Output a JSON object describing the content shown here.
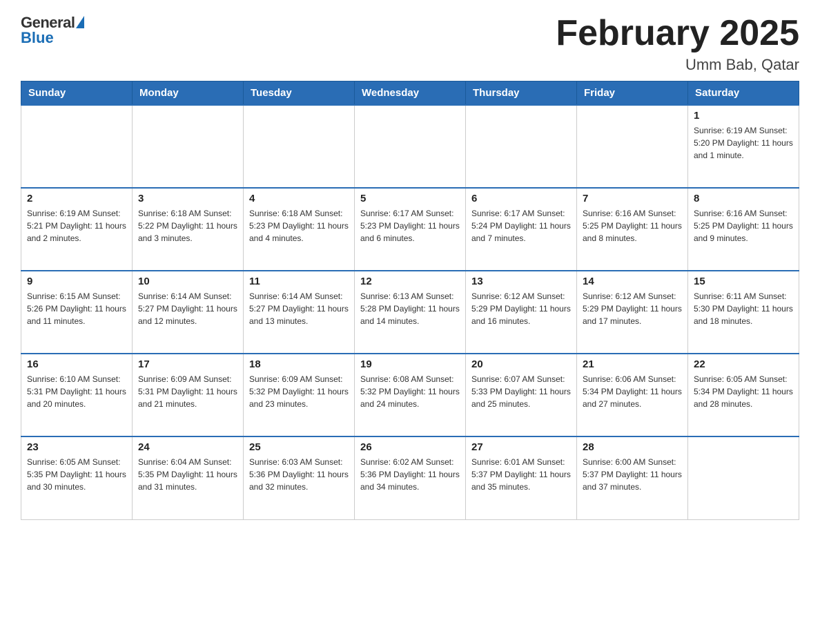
{
  "logo": {
    "general": "General",
    "blue": "Blue"
  },
  "header": {
    "title": "February 2025",
    "subtitle": "Umm Bab, Qatar"
  },
  "days_of_week": [
    "Sunday",
    "Monday",
    "Tuesday",
    "Wednesday",
    "Thursday",
    "Friday",
    "Saturday"
  ],
  "weeks": [
    [
      {
        "day": "",
        "info": ""
      },
      {
        "day": "",
        "info": ""
      },
      {
        "day": "",
        "info": ""
      },
      {
        "day": "",
        "info": ""
      },
      {
        "day": "",
        "info": ""
      },
      {
        "day": "",
        "info": ""
      },
      {
        "day": "1",
        "info": "Sunrise: 6:19 AM\nSunset: 5:20 PM\nDaylight: 11 hours and 1 minute."
      }
    ],
    [
      {
        "day": "2",
        "info": "Sunrise: 6:19 AM\nSunset: 5:21 PM\nDaylight: 11 hours and 2 minutes."
      },
      {
        "day": "3",
        "info": "Sunrise: 6:18 AM\nSunset: 5:22 PM\nDaylight: 11 hours and 3 minutes."
      },
      {
        "day": "4",
        "info": "Sunrise: 6:18 AM\nSunset: 5:23 PM\nDaylight: 11 hours and 4 minutes."
      },
      {
        "day": "5",
        "info": "Sunrise: 6:17 AM\nSunset: 5:23 PM\nDaylight: 11 hours and 6 minutes."
      },
      {
        "day": "6",
        "info": "Sunrise: 6:17 AM\nSunset: 5:24 PM\nDaylight: 11 hours and 7 minutes."
      },
      {
        "day": "7",
        "info": "Sunrise: 6:16 AM\nSunset: 5:25 PM\nDaylight: 11 hours and 8 minutes."
      },
      {
        "day": "8",
        "info": "Sunrise: 6:16 AM\nSunset: 5:25 PM\nDaylight: 11 hours and 9 minutes."
      }
    ],
    [
      {
        "day": "9",
        "info": "Sunrise: 6:15 AM\nSunset: 5:26 PM\nDaylight: 11 hours and 11 minutes."
      },
      {
        "day": "10",
        "info": "Sunrise: 6:14 AM\nSunset: 5:27 PM\nDaylight: 11 hours and 12 minutes."
      },
      {
        "day": "11",
        "info": "Sunrise: 6:14 AM\nSunset: 5:27 PM\nDaylight: 11 hours and 13 minutes."
      },
      {
        "day": "12",
        "info": "Sunrise: 6:13 AM\nSunset: 5:28 PM\nDaylight: 11 hours and 14 minutes."
      },
      {
        "day": "13",
        "info": "Sunrise: 6:12 AM\nSunset: 5:29 PM\nDaylight: 11 hours and 16 minutes."
      },
      {
        "day": "14",
        "info": "Sunrise: 6:12 AM\nSunset: 5:29 PM\nDaylight: 11 hours and 17 minutes."
      },
      {
        "day": "15",
        "info": "Sunrise: 6:11 AM\nSunset: 5:30 PM\nDaylight: 11 hours and 18 minutes."
      }
    ],
    [
      {
        "day": "16",
        "info": "Sunrise: 6:10 AM\nSunset: 5:31 PM\nDaylight: 11 hours and 20 minutes."
      },
      {
        "day": "17",
        "info": "Sunrise: 6:09 AM\nSunset: 5:31 PM\nDaylight: 11 hours and 21 minutes."
      },
      {
        "day": "18",
        "info": "Sunrise: 6:09 AM\nSunset: 5:32 PM\nDaylight: 11 hours and 23 minutes."
      },
      {
        "day": "19",
        "info": "Sunrise: 6:08 AM\nSunset: 5:32 PM\nDaylight: 11 hours and 24 minutes."
      },
      {
        "day": "20",
        "info": "Sunrise: 6:07 AM\nSunset: 5:33 PM\nDaylight: 11 hours and 25 minutes."
      },
      {
        "day": "21",
        "info": "Sunrise: 6:06 AM\nSunset: 5:34 PM\nDaylight: 11 hours and 27 minutes."
      },
      {
        "day": "22",
        "info": "Sunrise: 6:05 AM\nSunset: 5:34 PM\nDaylight: 11 hours and 28 minutes."
      }
    ],
    [
      {
        "day": "23",
        "info": "Sunrise: 6:05 AM\nSunset: 5:35 PM\nDaylight: 11 hours and 30 minutes."
      },
      {
        "day": "24",
        "info": "Sunrise: 6:04 AM\nSunset: 5:35 PM\nDaylight: 11 hours and 31 minutes."
      },
      {
        "day": "25",
        "info": "Sunrise: 6:03 AM\nSunset: 5:36 PM\nDaylight: 11 hours and 32 minutes."
      },
      {
        "day": "26",
        "info": "Sunrise: 6:02 AM\nSunset: 5:36 PM\nDaylight: 11 hours and 34 minutes."
      },
      {
        "day": "27",
        "info": "Sunrise: 6:01 AM\nSunset: 5:37 PM\nDaylight: 11 hours and 35 minutes."
      },
      {
        "day": "28",
        "info": "Sunrise: 6:00 AM\nSunset: 5:37 PM\nDaylight: 11 hours and 37 minutes."
      },
      {
        "day": "",
        "info": ""
      }
    ]
  ]
}
